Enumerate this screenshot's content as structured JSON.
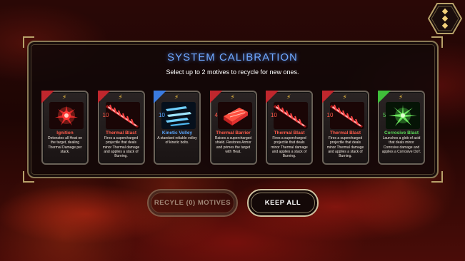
{
  "header": {
    "menu_icon": "vertical-dots-icon",
    "title": "SYSTEM CALIBRATION",
    "subtitle": "Select up to 2 motives to recycle for new ones."
  },
  "colors": {
    "title": "#6fa8ff",
    "gold_trim": "#b8a26a",
    "red_rarity": "#c0272d",
    "blue_rarity": "#3a7be0",
    "green_rarity": "#3fbf3a"
  },
  "cards": [
    {
      "name": "Ignition",
      "level": "",
      "rarity": "red",
      "name_color": "#ff5a4a",
      "art_icon": "red-burst-icon",
      "description": "Detonates all Heat on the target, dealing Thermal Damage per stack."
    },
    {
      "name": "Thermal Blast",
      "level": "10",
      "rarity": "red",
      "name_color": "#ff5a4a",
      "art_icon": "red-spike-beam-icon",
      "description": "Fires a supercharged projectile that deals minor Thermal damage and applies a stack of Burning."
    },
    {
      "name": "Kinetic Volley",
      "level": "10",
      "rarity": "blue",
      "name_color": "#5aa7ff",
      "art_icon": "blue-volley-icon",
      "description": "A standard reliable volley of kinetic bolts."
    },
    {
      "name": "Thermal Barrier",
      "level": "4",
      "rarity": "red",
      "name_color": "#ff5a4a",
      "art_icon": "red-barrier-icon",
      "description": "Raises a supercharged shield. Restores Armor and primes the target with Heat."
    },
    {
      "name": "Thermal Blast",
      "level": "10",
      "rarity": "red",
      "name_color": "#ff5a4a",
      "art_icon": "red-spike-beam-icon",
      "description": "Fires a supercharged projectile that deals minor Thermal damage and applies a stack of Burning."
    },
    {
      "name": "Thermal Blast",
      "level": "10",
      "rarity": "red",
      "name_color": "#ff5a4a",
      "art_icon": "red-spike-beam-icon",
      "description": "Fires a supercharged projectile that deals minor Thermal damage and applies a stack of Burning."
    },
    {
      "name": "Corrosive Blast",
      "level": "5",
      "rarity": "green",
      "name_color": "#59d957",
      "art_icon": "green-acid-burst-icon",
      "description": "Launches a glob of acid that deals minor Corrosive damage and applies a Corrosive DoT."
    }
  ],
  "buttons": {
    "recycle_label": "RECYLE (0) MOTIVES",
    "keep_label": "KEEP ALL"
  }
}
